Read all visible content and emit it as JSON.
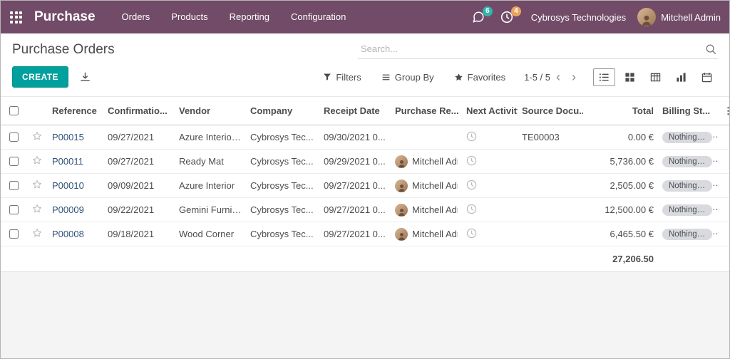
{
  "navbar": {
    "brand": "Purchase",
    "menu": [
      "Orders",
      "Products",
      "Reporting",
      "Configuration"
    ],
    "messages_badge": "6",
    "activities_badge": "4",
    "company": "Cybrosys Technologies",
    "user": "Mitchell Admin"
  },
  "control": {
    "title": "Purchase Orders",
    "search_placeholder": "Search...",
    "create": "CREATE",
    "filters": "Filters",
    "group_by": "Group By",
    "favorites": "Favorites",
    "pager": "1-5 / 5"
  },
  "table": {
    "headers": {
      "reference": "Reference",
      "confirmation": "Confirmatio...",
      "vendor": "Vendor",
      "company": "Company",
      "receipt": "Receipt Date",
      "rep": "Purchase Re...",
      "activity": "Next Activity",
      "source": "Source Docu...",
      "total": "Total",
      "billing": "Billing St..."
    },
    "rows": [
      {
        "reference": "P00015",
        "confirmation": "09/27/2021",
        "vendor": "Azure Interior, ...",
        "company": "Cybrosys Tec...",
        "receipt": "09/30/2021 0...",
        "rep": "",
        "source": "TE00003",
        "total": "0.00 €",
        "billing": "Nothing to...",
        "suffix": "..."
      },
      {
        "reference": "P00011",
        "confirmation": "09/27/2021",
        "vendor": "Ready Mat",
        "company": "Cybrosys Tec...",
        "receipt": "09/29/2021 0...",
        "rep": "Mitchell Adr",
        "source": "",
        "total": "5,736.00 €",
        "billing": "Nothing to...",
        "suffix": "..."
      },
      {
        "reference": "P00010",
        "confirmation": "09/09/2021",
        "vendor": "Azure Interior",
        "company": "Cybrosys Tec...",
        "receipt": "09/27/2021 0...",
        "rep": "Mitchell Adr",
        "source": "",
        "total": "2,505.00 €",
        "billing": "Nothing to...",
        "suffix": "..."
      },
      {
        "reference": "P00009",
        "confirmation": "09/22/2021",
        "vendor": "Gemini Furnit...",
        "company": "Cybrosys Tec...",
        "receipt": "09/27/2021 0...",
        "rep": "Mitchell Adr",
        "source": "",
        "total": "12,500.00 €",
        "billing": "Nothing to...",
        "suffix": "..."
      },
      {
        "reference": "P00008",
        "confirmation": "09/18/2021",
        "vendor": "Wood Corner",
        "company": "Cybrosys Tec...",
        "receipt": "09/27/2021 0...",
        "rep": "Mitchell Adr",
        "source": "",
        "total": "6,465.50 €",
        "billing": "Nothing to...",
        "suffix": "..."
      }
    ],
    "sum_total": "27,206.50"
  },
  "colors": {
    "navbar": "#714B67",
    "primary_button": "#00A09D",
    "messages_badge_bg": "#31b5ac",
    "activities_badge_bg": "#eba55a",
    "badge_pill_bg": "#d8dadd"
  }
}
